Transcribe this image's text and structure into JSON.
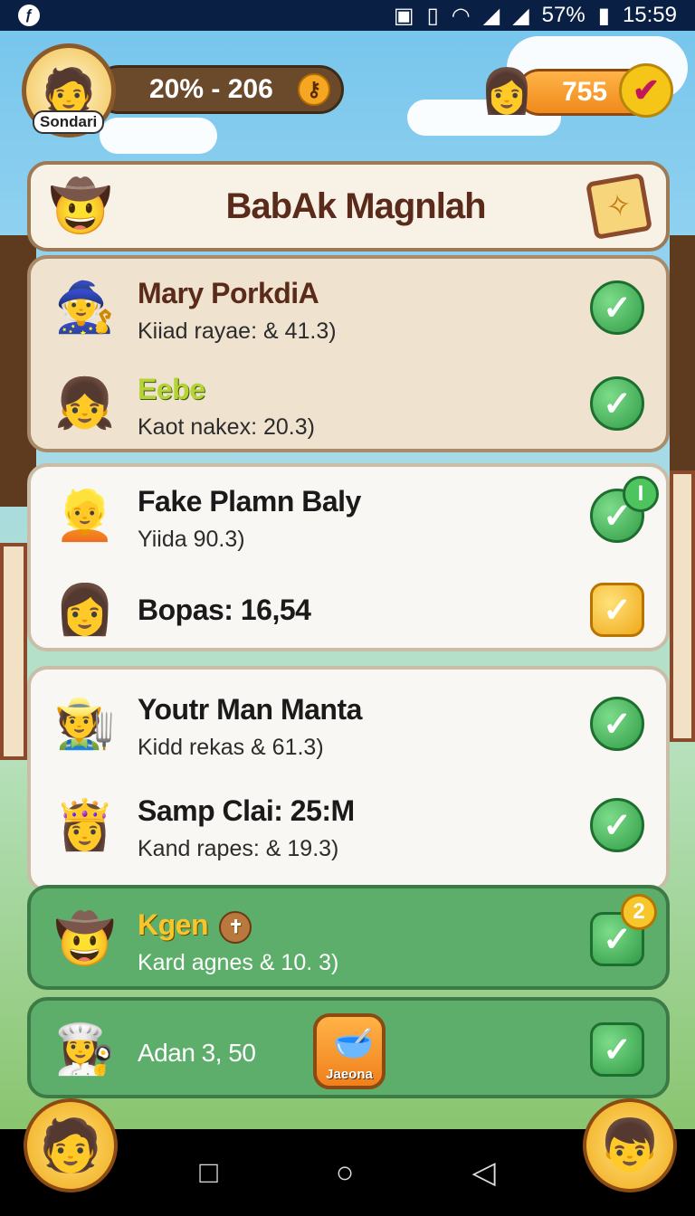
{
  "status_bar": {
    "battery": "57%",
    "time": "15:59"
  },
  "hud": {
    "player_badge": "Sondari",
    "progress_text": "20% - 206",
    "currency_value": "755"
  },
  "title": "BabAk Magnlah",
  "rows": [
    {
      "name": "Mary PorkdiA",
      "detail": "Kiiad rayae: & 41.3)"
    },
    {
      "name": "Eebe",
      "detail": "Kaot nakex: 20.3)"
    },
    {
      "name": "Fake Plamn Baly",
      "detail": "Yiida 90.3)",
      "badge": "I"
    },
    {
      "name": "Bopas:  16,54"
    },
    {
      "name": "Youtr Man Manta",
      "detail": "Kidd rekas & 61.3)"
    },
    {
      "name": "Samp Clai: 25:M",
      "detail": "Kand rapes: & 19.3)"
    },
    {
      "name": "Kgen",
      "detail": "Kard agnes & 10. 3)",
      "badge": "2"
    },
    {
      "name": "Adan 3, 50"
    }
  ],
  "jar_label": "Jaeona",
  "colors": {
    "status_bar": "#0a1f44",
    "check_green": "#2f9a45",
    "check_yellow": "#f0a91a",
    "title_text": "#5a2a1a"
  }
}
